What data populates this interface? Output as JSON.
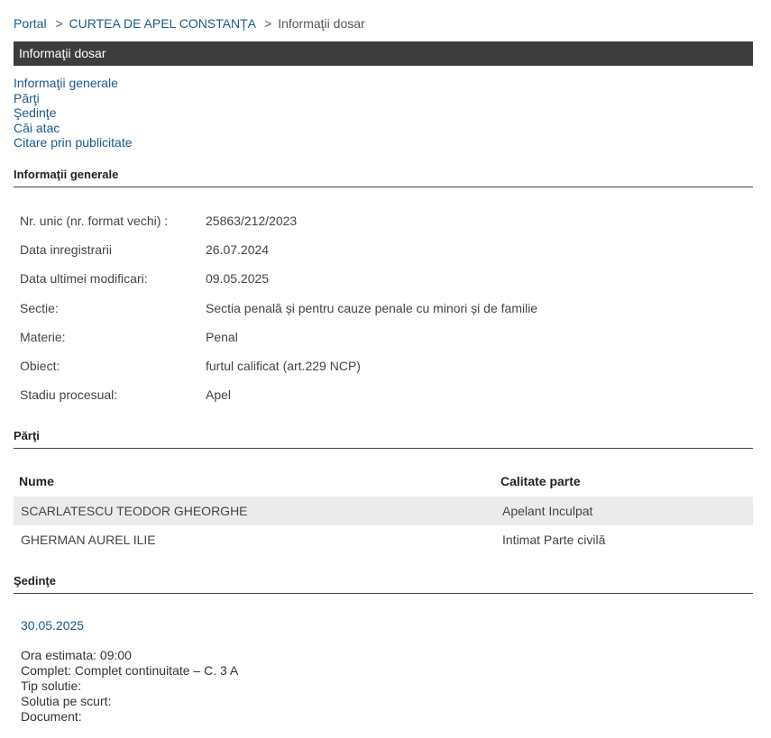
{
  "breadcrumb": {
    "items": [
      "Portal",
      "CURTEA DE APEL CONSTANȚA",
      "Informaţii dosar"
    ],
    "separator": ">"
  },
  "title": "Informaţii dosar",
  "toc": [
    "Informaţii generale",
    "Părţi",
    "Şedinţe",
    "Căi atac",
    "Citare prin publicitate"
  ],
  "sections": {
    "general": "Informaţii generale",
    "parti": "Părţi",
    "sedinte": "Şedinţe"
  },
  "general_info": [
    {
      "label": "Nr. unic (nr. format vechi) :",
      "value": "25863/212/2023"
    },
    {
      "label": "Data inregistrarii",
      "value": "26.07.2024"
    },
    {
      "label": "Data ultimei modificari:",
      "value": "09.05.2025"
    },
    {
      "label": "Sectie:",
      "value": "Sectia penală și pentru cauze penale cu minori și de familie"
    },
    {
      "label": "Materie:",
      "value": "Penal"
    },
    {
      "label": "Obiect:",
      "value": "furtul calificat (art.229 NCP)"
    },
    {
      "label": "Stadiu procesual:",
      "value": "Apel"
    }
  ],
  "parti_table": {
    "headers": [
      "Nume",
      "Calitate parte"
    ],
    "rows": [
      [
        "SCARLATESCU TEODOR GHEORGHE",
        "Apelant Inculpat"
      ],
      [
        "GHERMAN AUREL ILIE",
        "Intimat Parte civilă"
      ]
    ]
  },
  "sedinta": {
    "date": "30.05.2025",
    "details": [
      "Ora estimata: 09:00",
      "Complet: Complet continuitate – C. 3 A",
      "Tip solutie:",
      "Solutia pe scurt:",
      "Document:"
    ]
  }
}
